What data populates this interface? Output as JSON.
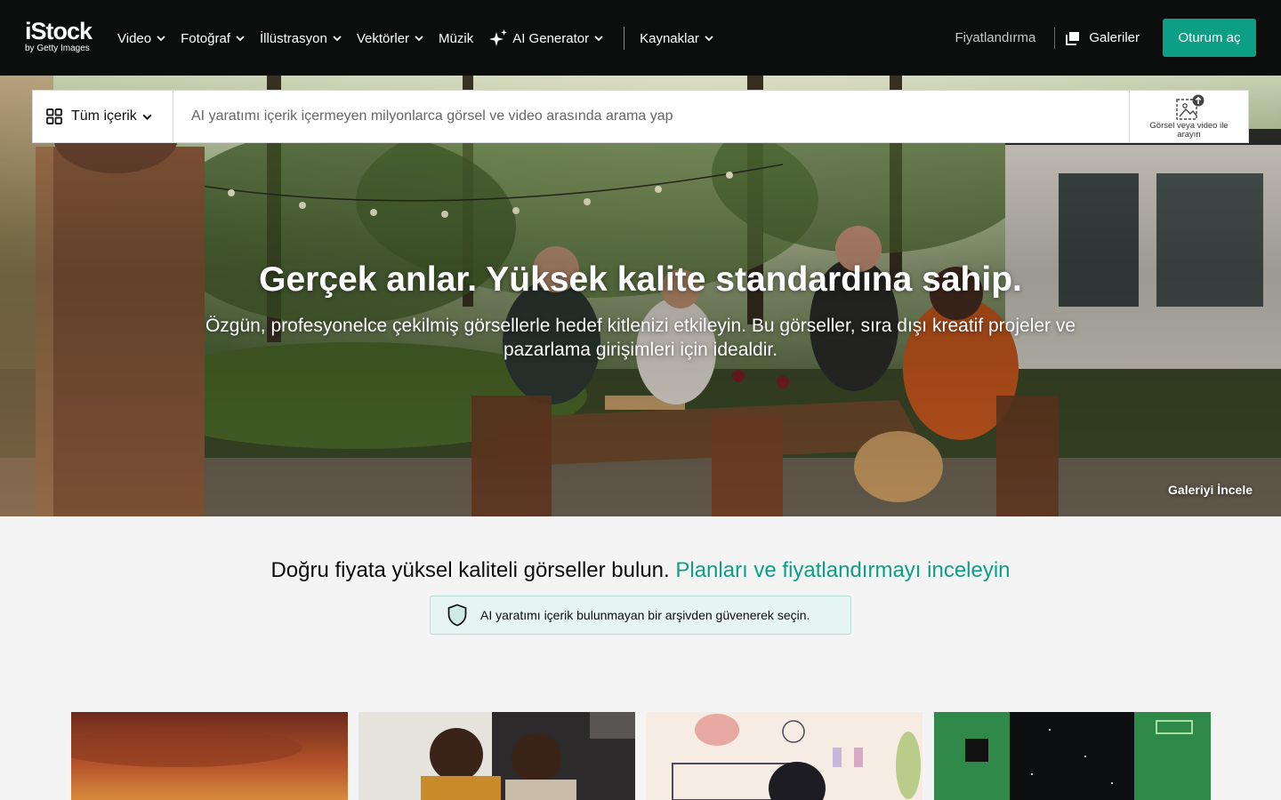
{
  "header": {
    "logo": {
      "name": "iStock",
      "tagline": "by Getty Images"
    },
    "nav": [
      {
        "label": "Video",
        "dropdown": true
      },
      {
        "label": "Fotoğraf",
        "dropdown": true
      },
      {
        "label": "İllüstrasyon",
        "dropdown": true
      },
      {
        "label": "Vektörler",
        "dropdown": true
      },
      {
        "label": "Müzik",
        "dropdown": false
      },
      {
        "label": "AI Generator",
        "dropdown": true,
        "icon": "sparkle-icon"
      },
      {
        "label": "Kaynaklar",
        "dropdown": true
      }
    ],
    "pricing_label": "Fiyatlandırma",
    "boards_label": "Galeriler",
    "signin_label": "Oturum aç"
  },
  "search": {
    "scope_label": "Tüm içerik",
    "placeholder": "AI yaratımı içerik içermeyen milyonlarca görsel ve video arasında arama yap",
    "visual_search_label": "Görsel veya video ile arayın"
  },
  "hero": {
    "title": "Gerçek anlar. Yüksek kalite standardına sahip.",
    "subtitle": "Özgün, profesyonelce çekilmiş görsellerle hedef kitlenizi etkileyin. Bu görseller, sıra dışı kreatif projeler ve pazarlama girişimleri için idealdir.",
    "gallery_link": "Galeriyi İncele"
  },
  "promo": {
    "text": "Doğru fiyata yüksel kaliteli görseller bulun.",
    "cta": "Planları ve fiyatlandırmayı inceleyin"
  },
  "trust": {
    "text": "AI yaratımı içerik bulunmayan bir arşivden güvenerek seçin."
  },
  "colors": {
    "header_bg": "#0c0d0d",
    "accent": "#0c9f85",
    "trust_bg": "#e6f4f2",
    "page_bg": "#f4f4f4"
  }
}
